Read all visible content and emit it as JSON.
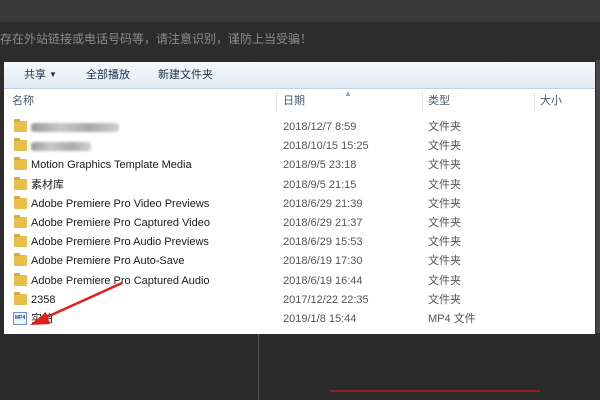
{
  "background": {
    "notice_text": "存在外站链接或电话号码等，请注意识别，谨防上当受骗！"
  },
  "toolbar": {
    "share_label": "共享",
    "play_all_label": "全部播放",
    "new_folder_label": "新建文件夹"
  },
  "columns": {
    "name": "名称",
    "date": "日期",
    "type": "类型",
    "size": "大小"
  },
  "files": [
    {
      "name": "",
      "date": "2018/12/7 8:59",
      "type": "文件夹",
      "icon": "folder-icon",
      "obscured": true
    },
    {
      "name": "",
      "date": "2018/10/15 15:25",
      "type": "文件夹",
      "icon": "folder-icon",
      "obscured": true
    },
    {
      "name": "Motion Graphics Template Media",
      "date": "2018/9/5 23:18",
      "type": "文件夹",
      "icon": "folder-icon"
    },
    {
      "name": "素材库",
      "date": "2018/9/5 21:15",
      "type": "文件夹",
      "icon": "folder-icon"
    },
    {
      "name": "Adobe Premiere Pro Video Previews",
      "date": "2018/6/29 21:39",
      "type": "文件夹",
      "icon": "folder-icon"
    },
    {
      "name": "Adobe Premiere Pro Captured Video",
      "date": "2018/6/29 21:37",
      "type": "文件夹",
      "icon": "folder-icon"
    },
    {
      "name": "Adobe Premiere Pro Audio Previews",
      "date": "2018/6/29 15:53",
      "type": "文件夹",
      "icon": "folder-icon"
    },
    {
      "name": "Adobe Premiere Pro Auto-Save",
      "date": "2018/6/19 17:30",
      "type": "文件夹",
      "icon": "folder-icon"
    },
    {
      "name": "Adobe Premiere Pro Captured Audio",
      "date": "2018/6/19 16:44",
      "type": "文件夹",
      "icon": "folder-icon"
    },
    {
      "name": "2358",
      "date": "2017/12/22 22:35",
      "type": "文件夹",
      "icon": "folder-icon"
    },
    {
      "name": "实拍",
      "date": "2019/1/8 15:44",
      "type": "MP4 文件",
      "icon": "mp4-file-icon"
    }
  ],
  "colors": {
    "folder": "#e8bf4a",
    "annotation_arrow": "#e0201b"
  }
}
